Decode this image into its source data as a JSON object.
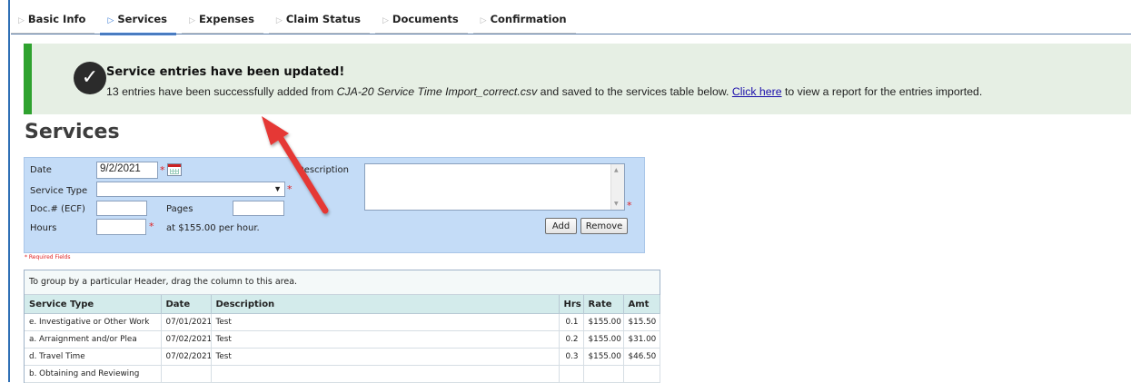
{
  "tabs": [
    {
      "label": "Basic Info",
      "active": false
    },
    {
      "label": "Services",
      "active": true
    },
    {
      "label": "Expenses",
      "active": false
    },
    {
      "label": "Claim Status",
      "active": false
    },
    {
      "label": "Documents",
      "active": false
    },
    {
      "label": "Confirmation",
      "active": false
    }
  ],
  "banner": {
    "title": "Service entries have been updated!",
    "msg_prefix": "13 entries have been successfully added from ",
    "file_name": "CJA-20 Service Time Import_correct.csv",
    "msg_middle": " and saved to the services table below. ",
    "link_text": "Click here",
    "msg_suffix": " to view a report for the entries imported.",
    "accent_color": "#2fa22f"
  },
  "page_title": "Services",
  "form": {
    "date_label": "Date",
    "date_value": "9/2/2021",
    "service_type_label": "Service Type",
    "service_type_value": "",
    "doc_label": "Doc.# (ECF)",
    "doc_value": "",
    "pages_label": "Pages",
    "pages_value": "",
    "hours_label": "Hours",
    "hours_value": "",
    "rate_text": "at $155.00 per hour.",
    "description_label": "Description",
    "description_value": "",
    "add_button": "Add",
    "remove_button": "Remove",
    "required_note": "* Required Fields",
    "required_marker": "*"
  },
  "grid": {
    "group_hint": "To group by a particular Header, drag the column to this area.",
    "columns": [
      "Service Type",
      "Date",
      "Description",
      "Hrs",
      "Rate",
      "Amt"
    ],
    "rows": [
      [
        "e. Investigative or Other Work",
        "07/01/2021",
        "Test",
        "0.1",
        "$155.00",
        "$15.50"
      ],
      [
        "a. Arraignment and/or Plea",
        "07/02/2021",
        "Test",
        "0.2",
        "$155.00",
        "$31.00"
      ],
      [
        "d. Travel Time",
        "07/02/2021",
        "Test",
        "0.3",
        "$155.00",
        "$46.50"
      ],
      [
        "b. Obtaining and Reviewing",
        "",
        "",
        "",
        "",
        ""
      ]
    ]
  }
}
